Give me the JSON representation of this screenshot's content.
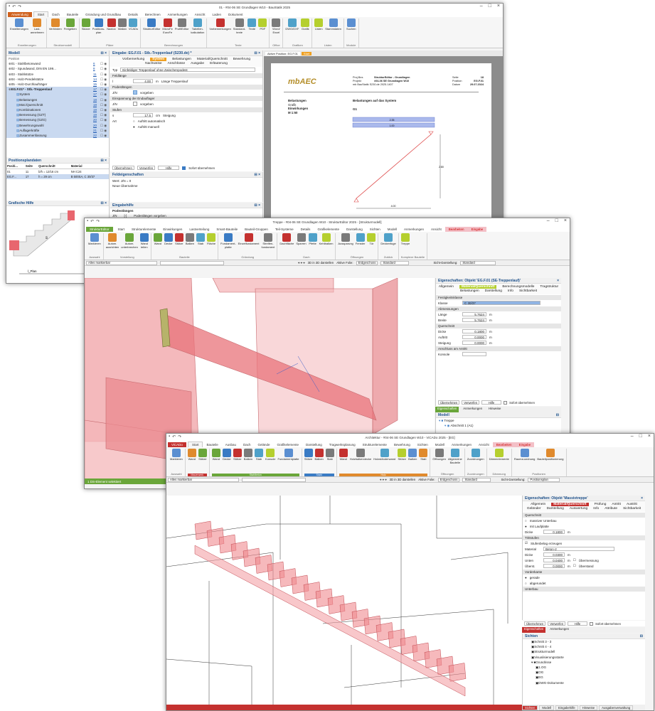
{
  "colors": {
    "file_tab_w1": "#d0611d",
    "file_tab_w2": "#6aa63a",
    "file_tab_w3": "#c4312f",
    "accent": "#b5cf2e",
    "member_red": "#e8666e",
    "select_blue": "#c9d9f0"
  },
  "w1": {
    "title": "01 - #04-06 SE Grundlagen W10 - BauStatik 2025",
    "file_tab": "Anwendung",
    "tabs": [
      "Start",
      "Dach",
      "Bauteile",
      "Gründung und Grundbau",
      "Details",
      "Berechnen",
      "Anmerkungen",
      "Ansicht",
      "Laden",
      "Dokument"
    ],
    "ribbon_groups": [
      {
        "label": "Erweiterungen",
        "buttons": [
          "Erweiterungen",
          "Last-\nannehmen"
        ]
      },
      {
        "label": "Strukturmodell",
        "buttons": [
          "Verbinden",
          "Freigeben"
        ]
      },
      {
        "label": "Pläne",
        "buttons": [
          "Skizze",
          "Positions-\nplan",
          "Naxtox",
          "Wallan",
          "VCADs"
        ]
      },
      {
        "label": "Berechnungen",
        "buttons": [
          "StrukturEditor",
          "MicroFe\nEuroFe",
          "ProfilEditor",
          "Tabellen-\nkalkulation"
        ]
      },
      {
        "label": "Texte",
        "buttons": [
          "Vorbemerkungen",
          "Standard-\ntexte",
          "Texte",
          "PDF"
        ]
      },
      {
        "label": "Office",
        "buttons": [
          "Word/\nExcel"
        ]
      },
      {
        "label": "Grafiken",
        "buttons": [
          "DWG/DXF",
          "Grafik"
        ]
      },
      {
        "label": "Listen",
        "buttons": [
          "Listen",
          "Stammdaten"
        ]
      },
      {
        "label": "Module",
        "buttons": [
          "Suchen"
        ]
      }
    ],
    "model_panel": {
      "title": "Modell",
      "position_label": "Position",
      "items": [
        {
          "name": "01 - Stahlbetonwand",
          "nr": "6",
          "sel": false
        },
        {
          "name": "02 - Spundwand, DIN EN 199...",
          "nr": "8",
          "sel": false
        },
        {
          "name": "03 - Stahlstütze",
          "nr": "11",
          "sel": false
        },
        {
          "name": "04 - Holz-Pendelstütze",
          "nr": "14",
          "sel": false
        },
        {
          "name": "05 - Holz-Durchlaufträger",
          "nr": "15",
          "sel": false
        },
        {
          "name": "EG.F.01* - Stb.-Treppenlauf",
          "nr": "17",
          "sel": true
        },
        {
          "name": "System",
          "nr": "17",
          "sel": true
        },
        {
          "name": "Belastungen",
          "nr": "18",
          "sel": true
        },
        {
          "name": "Mat./Querschnitt",
          "nr": "18",
          "sel": true
        },
        {
          "name": "Kombinationen",
          "nr": "19",
          "sel": true
        },
        {
          "name": "Bemessung (GZT)",
          "nr": "19",
          "sel": true
        },
        {
          "name": "Bemessung (GZG)",
          "nr": "20",
          "sel": true
        },
        {
          "name": "Bewehrungswahl",
          "nr": "20",
          "sel": true
        },
        {
          "name": "Auflagerkräfte",
          "nr": "21",
          "sel": true
        },
        {
          "name": "Zusammenfassung",
          "nr": "22",
          "sel": true
        }
      ]
    },
    "positions_panel": {
      "title": "Positionsplandaten",
      "headers": [
        "Positi...",
        "Seite",
        "Querschnitt",
        "Material"
      ],
      "rows": [
        [
          "01",
          "11",
          "b/h = 12/16 cm",
          "NH C24"
        ],
        [
          "EG.F...",
          "17",
          "h = 29 cm",
          "B 500SA, C 30/37"
        ]
      ]
    },
    "graphic_panel": {
      "title": "Grafische Hilfe",
      "label_s": "s",
      "label_lplan": "l_Plan"
    },
    "input_panel": {
      "title": "Eingabe: EG.F.01 - Stb.-Treppenlauf (S230.de) *",
      "tabs": [
        "Vorbemerkung",
        "System",
        "Belastungen",
        "Material/Querschnitt",
        "Bewehrung",
        "Nachweise",
        "Anschlüsse",
        "Ausgabe",
        "Erläuterung"
      ],
      "typ_label": "Typ",
      "typ_value": "Einfeldiger Treppenlauf ohne Zwischenpodest",
      "feldlaenge": "Feldlänge",
      "l_label": "l",
      "l_value": "4.00",
      "l_unit": "m",
      "l_desc": "Länge Treppenlauf",
      "podest": "Podestlängen",
      "jn_label": "J/N",
      "vorgeben": "vorgeben",
      "einspannung": "Einspannung der Endauflager",
      "stufen": "Stufen",
      "s_label": "s",
      "s_value": "17.5",
      "s_unit": "cm",
      "s_desc": "Steigung",
      "art_label": "Art",
      "art_opt1": "Auftritt automatisch",
      "art_opt2": "Auftritt manuell",
      "btn_uebernehmen": "Übernehmen",
      "btn_verwerfen": "Verwerfen",
      "btn_hilfe": "Hilfe",
      "sofort": "Sofort übernehmen"
    },
    "field_props": {
      "title": "Feldeigenschaften",
      "line1": "Wert: J/N = 0",
      "line2": "Neue Übernahme"
    },
    "eingabehilfe": {
      "title": "Eingabehilfe",
      "sub": "Podestlängen",
      "jn": "J/N",
      "val": "[-]",
      "desc": "Podestlängen vorgeben"
    },
    "doc": {
      "tab1": "Aktive Position: EG.F.01",
      "tab2": "Start",
      "logo": "mbAEC",
      "header_l": [
        "Proj.Bez.",
        "Projekt",
        "mb BauStatik S230.de 2025.1407"
      ],
      "header_m": [
        "StrukturEditor - Grundlagen",
        "#04-06 SE Grundlagen W10",
        ""
      ],
      "header_r": [
        "Seite",
        "Position",
        "Datum"
      ],
      "header_rv": [
        "18",
        "EG.F.01",
        "29.07.2024"
      ],
      "left": [
        "Belastungen",
        "Grafik",
        "Einwirkungen",
        "M 1:50"
      ],
      "right_title": "Belastungen auf das System",
      "right_g": "G1",
      "dim_bottom": "4.00",
      "dim_right": "2.80",
      "load1": "2.35",
      "load2": "1.00"
    }
  },
  "w2": {
    "title": "Treppe - #04-06 SE Grundlagen W10 - StrukturEditor 2025 - [Strukturmodell]",
    "file_tab": "StrukturEditor",
    "tabs": [
      "Start",
      "Strukturelemente",
      "Einwirkungen",
      "Lastverteilung",
      "Smart-Bauteile",
      "Bauteil-Gruppen",
      "Teil-Systeme",
      "Details",
      "Grafikelemente",
      "Darstellung",
      "Sichten",
      "Modell",
      "Anmerkungen",
      "Ansicht",
      "Bearbeiten",
      "Eingabe"
    ],
    "ribbon_groups": [
      {
        "label": "Auswahl",
        "buttons": [
          "Markieren"
        ],
        "bar": ""
      },
      {
        "label": "Vorstellung",
        "buttons": [
          "Autom.\nausrichten",
          "Autom.\nunterbrechen",
          "Wand\nteilen"
        ],
        "bar": ""
      },
      {
        "label": "Bauteile",
        "buttons": [
          "Wand",
          "Decke",
          "Stütze",
          "Balken",
          "Stab",
          "Fläche"
        ],
        "bar": ""
      },
      {
        "label": "Gründung",
        "buttons": [
          "Fundament-\nplatte",
          "Einzelfundament",
          "Streifen-\nfundament"
        ],
        "bar": ""
      },
      {
        "label": "Dach",
        "buttons": [
          "Dachfläche",
          "Sparren",
          "Pfette",
          "Kehlbalken"
        ],
        "bar": ""
      },
      {
        "label": "Öffnungen",
        "buttons": [
          "Aussparung",
          "Fenster",
          "Tür"
        ],
        "bar": ""
      },
      {
        "label": "Zuklick",
        "buttons": [
          "Deckenfuge"
        ],
        "bar": ""
      },
      {
        "label": "Komplexe Bauteile",
        "buttons": [
          "Treppe"
        ],
        "bar": ""
      }
    ],
    "filter": "Alles markierbar",
    "view3d": "3D in 3D darstellen",
    "folie": "Aktive Folie:",
    "folie_val": "Erdgeschoss",
    "std": "Standard",
    "sicht": "Sicht-Darstellung:",
    "sicht_val": "Standard",
    "props": {
      "title": "Eigenschaften: Objekt 'EG.F.01 (SE-Treppenlauf)'",
      "tabs": [
        "Allgemein",
        "Material/Querschnitt",
        "Berechnungsmodelle",
        "Tragstruktur",
        "Belastungen",
        "Darstellung",
        "Info",
        "Sichtbarkeit"
      ],
      "rows": [
        {
          "t": "sect",
          "label": "Festigkeitsklasse"
        },
        {
          "t": "row",
          "label": "Klasse",
          "value": "C 30/37",
          "hl": true
        },
        {
          "t": "sect",
          "label": "Abmessungen"
        },
        {
          "t": "row",
          "label": "Länge",
          "value": "5.7624",
          "unit": "m"
        },
        {
          "t": "row",
          "label": "Breite",
          "value": "5.7624",
          "unit": "m"
        },
        {
          "t": "sect",
          "label": "Querschnitt"
        },
        {
          "t": "row",
          "label": "Dicke",
          "value": "0.1800",
          "unit": "m"
        },
        {
          "t": "row",
          "label": "Auftritt",
          "value": "0.0000",
          "unit": "m"
        },
        {
          "t": "row",
          "label": "Steigung",
          "value": "0.0000",
          "unit": "m"
        },
        {
          "t": "sect",
          "label": "Anschluss am Antritt"
        },
        {
          "t": "row",
          "label": "Konsole",
          "value": ""
        }
      ],
      "btn_uebernehmen": "Übernehmen",
      "btn_verwerfen": "Verwerfen",
      "btn_hilfe": "Hilfe",
      "sofort": "Sofort übernehmen",
      "bottom_tabs": [
        "Eigenschaften",
        "Anmerkungen",
        "Hinweise"
      ]
    },
    "model": {
      "title": "Modell",
      "item1": "Treppe",
      "item2": "Abschnitt 1 (A1)"
    },
    "status": "1 DS-Element selektiert"
  },
  "w3": {
    "title": "Architektur - #04-06 SE Grundlagen W10 - ViCADo 2025 - [EG]",
    "file_tab": "ViCADo",
    "tabs": [
      "Start",
      "Bauteile",
      "Ausbau",
      "Dach",
      "Gelände",
      "Grafikelemente",
      "Darstellung",
      "Tragwerksplanung",
      "Strukturelemente",
      "Bewehrung",
      "Sichten",
      "Modell",
      "Anmerkungen",
      "Ansicht",
      "Bearbeiten",
      "Eingabe"
    ],
    "ribbon_groups": [
      {
        "label": "Auswahl",
        "buttons": [
          "Markieren"
        ],
        "bar": "",
        "barcolor": ""
      },
      {
        "label": "Mauerwerk",
        "buttons": [
          "Wand",
          "Stütze"
        ],
        "bar": "Mauerwerk",
        "barcolor": "#c4312f"
      },
      {
        "label": "Stahlbeton",
        "buttons": [
          "Wand",
          "Decke",
          "Stütze",
          "Balken",
          "Stab",
          "Konsole",
          "Fundamentplatte"
        ],
        "bar": "Stahlbeton",
        "barcolor": "#6aa63a"
      },
      {
        "label": "Stahl",
        "buttons": [
          "Stütze",
          "Balken",
          "Stab"
        ],
        "bar": "Stahl",
        "barcolor": "#3a7bc4"
      },
      {
        "label": "Holz",
        "buttons": [
          "Wand",
          "Holzbalkendecke",
          "Holzständerwand",
          "Stütze",
          "Balken",
          "Stab"
        ],
        "bar": "Holz",
        "barcolor": "#e08a2d"
      },
      {
        "label": "Öffnungen",
        "buttons": [
          "Öffnungen",
          "Allgemeine\nBauteile"
        ],
        "bar": "",
        "barcolor": ""
      },
      {
        "label": "Zuordnungen",
        "buttons": [
          "Zuordnungen"
        ],
        "bar": "",
        "barcolor": ""
      },
      {
        "label": "Dämmung",
        "buttons": [
          "Dämmelemente"
        ],
        "bar": "",
        "barcolor": ""
      },
      {
        "label": "Positionen",
        "buttons": [
          "Raumzuordnung",
          "Bauteilpositionierung"
        ],
        "bar": "",
        "barcolor": ""
      }
    ],
    "filter": "Alles markierbar",
    "view3d": "3D in 3D darstellen",
    "folie": "Aktive Folie:",
    "folie_val": "Erdgeschoss",
    "std": "Standard",
    "sicht": "Sicht-Darstellung:",
    "sicht_val": "Positionsplan",
    "props": {
      "title": "Eigenschaften: Objekt 'Massivtreppe'",
      "tabs": [
        "Allgemein",
        "Material/Querschnitt",
        "Prüfung",
        "Antritt",
        "Austritt",
        "Geländer",
        "Darstellung",
        "Auswertung",
        "Info",
        "Attribute",
        "Sichtbarkeit"
      ],
      "querschnitt": "Querschnitt",
      "q_opt1": "massiver Unterbau",
      "q_opt2": "mit Laufplatte",
      "dicke": "Dicke",
      "dicke_val": "0.1800",
      "unit": "m",
      "trittstufen": "Trittstufen",
      "stufenbelag": "Stufenbelag erzeugen",
      "material": "Material",
      "material_val": "Beton-2",
      "dicke2": "Dicke",
      "dicke2_val": "0.0300",
      "unten": "Unten",
      "unten_val": "0.0400",
      "ueberst": "Überst.",
      "ueberst_val": "0.0000",
      "uebermessen": "Übermessung",
      "ueberstand": "Überstand",
      "vorderkante": "Vorderkante",
      "vk_opt1": "gerade",
      "vk_opt2": "abgerundet",
      "unterbau": "Unterbau",
      "btn_uebernehmen": "Übernehmen",
      "btn_verwerfen": "Verwerfen",
      "btn_hilfe": "Hilfe",
      "sofort": "Sofort übernehmen",
      "bottom_tabs": [
        "Eigenschaften",
        "Anmerkungen"
      ]
    },
    "sichten": {
      "title": "Sichten",
      "items": [
        "Schnitt 3 - 3",
        "Schnitt 4 - 4",
        "Strukturmodell",
        "Visualisierungsstarte",
        "Grundrisse",
        "1.OG",
        "OG",
        "EG",
        "DWG-Dokumente"
      ]
    },
    "status_tabs": [
      "Sichten",
      "Modell",
      "Eingabehilfe",
      "Hinweise",
      "Ausgabenverwaltung"
    ]
  }
}
